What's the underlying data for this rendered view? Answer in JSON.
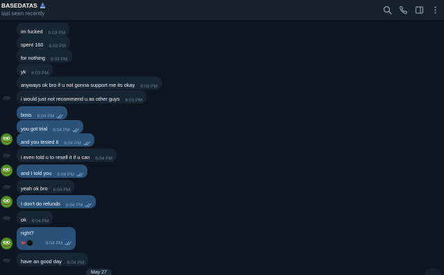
{
  "header": {
    "title": "BASEDATAS",
    "status": "last seen recently"
  },
  "icons": {
    "search": "search-icon",
    "call": "phone-icon",
    "sidebar": "sidebar-toggle-icon",
    "more": "more-vertical-icon"
  },
  "colors": {
    "background": "#0e1621",
    "header": "#17212b",
    "incoming": "#182533",
    "outgoing": "#2b5278",
    "reaction": "#e0454f"
  },
  "messages": [
    {
      "text": "im fucked",
      "time": "6:03 PM",
      "dir": "in"
    },
    {
      "text": "spent 160",
      "time": "6:03 PM",
      "dir": "in"
    },
    {
      "text": "for nothing",
      "time": "6:03 PM",
      "dir": "in"
    },
    {
      "text": "yk",
      "time": "6:03 PM",
      "dir": "in"
    },
    {
      "text": "anyways ok bro if u not gonna support me its okay",
      "time": "6:03 PM",
      "dir": "in"
    },
    {
      "text": "i would just not recommend u as other guys",
      "time": "6:03 PM",
      "dir": "in"
    },
    {
      "text": "boss",
      "time": "6:04 PM",
      "dir": "out"
    },
    {
      "text": "you got trial",
      "time": "6:04 PM",
      "dir": "out"
    },
    {
      "text": "and you tested it",
      "time": "6:04 PM",
      "dir": "out"
    },
    {
      "text": "i even told u to resell it if u can",
      "time": "6:04 PM",
      "dir": "in"
    },
    {
      "text": "and I told you",
      "time": "6:04 PM",
      "dir": "out"
    },
    {
      "text": "yeah ok bro",
      "time": "6:04 PM",
      "dir": "in"
    },
    {
      "text": "I don't do refunds",
      "time": "6:04 PM",
      "dir": "out"
    },
    {
      "text": "ok",
      "time": "6:04 PM",
      "dir": "in"
    },
    {
      "text": "right?",
      "time": "6:04 PM",
      "dir": "out",
      "reaction": "❤"
    },
    {
      "text": "have an good day",
      "time": "6:04 PM",
      "dir": "in"
    }
  ],
  "date_divider": "May 27"
}
